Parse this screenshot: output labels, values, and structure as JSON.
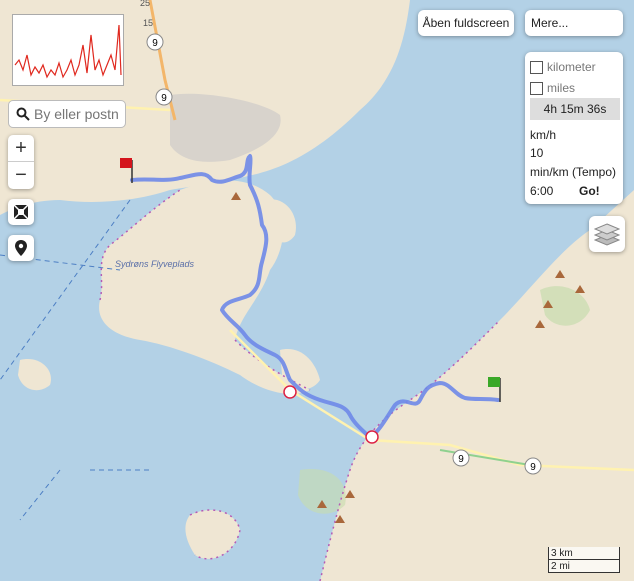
{
  "toolbar": {
    "fullscreen_label": "Åben fuldscreen",
    "more_label": "Mere..."
  },
  "search": {
    "placeholder": "By eller postn"
  },
  "zoom": {
    "in_label": "+",
    "out_label": "−"
  },
  "units": {
    "km_label": "kilometer",
    "miles_label": "miles",
    "km_checked": false,
    "miles_checked": false
  },
  "time": {
    "duration": "4h 15m 36s"
  },
  "speed": {
    "kmh_label": "km/h",
    "kmh_value": "10",
    "pace_label": "min/km (Tempo)",
    "pace_value": "6:00",
    "go_label": "Go!"
  },
  "map": {
    "airport_label": "Sydrøns Flyveplads",
    "road_shields": [
      "9",
      "9",
      "9",
      "9"
    ],
    "top_road_numbers": [
      "25",
      "15"
    ]
  },
  "scale": {
    "km_label": "3 km",
    "mi_label": "2 mi"
  },
  "colors": {
    "sea": "#b3d1e6",
    "land": "#efe6d3",
    "route": "#6e88e8",
    "coast_dots": "#b55bb5",
    "start_flag": "#d4141c",
    "end_flag": "#3aa827",
    "elevation_line": "#e0281e"
  }
}
